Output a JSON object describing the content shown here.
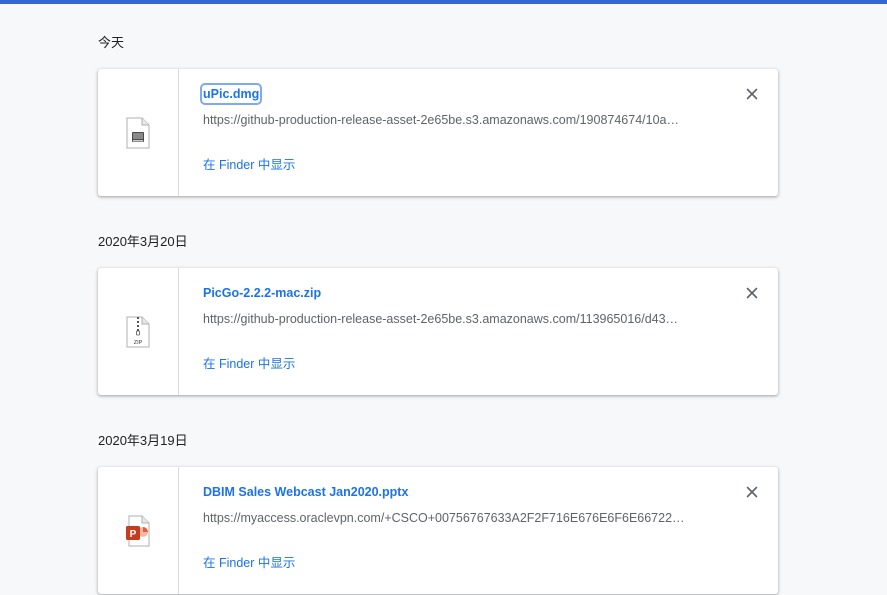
{
  "groups": [
    {
      "date": "今天",
      "item": {
        "name": "uPic.dmg",
        "url": "https://github-production-release-asset-2e65be.s3.amazonaws.com/190874674/10a…",
        "show_in_finder": "在 Finder 中显示",
        "icon": "disk-image-icon"
      }
    },
    {
      "date": "2020年3月20日",
      "item": {
        "name": "PicGo-2.2.2-mac.zip",
        "url": "https://github-production-release-asset-2e65be.s3.amazonaws.com/113965016/d43…",
        "show_in_finder": "在 Finder 中显示",
        "icon": "zip-file-icon",
        "icon_text": "ZIP"
      }
    },
    {
      "date": "2020年3月19日",
      "item": {
        "name": "DBIM Sales Webcast Jan2020.pptx",
        "url": "https://myaccess.oraclevpn.com/+CSCO+00756767633A2F2F716E676E6F6E66722…",
        "show_in_finder": "在 Finder 中显示",
        "icon": "powerpoint-file-icon",
        "icon_text": "P"
      }
    }
  ],
  "colors": {
    "accent": "#1a73e8",
    "top_bar": "#3367d6",
    "background": "#f7f8fa"
  }
}
